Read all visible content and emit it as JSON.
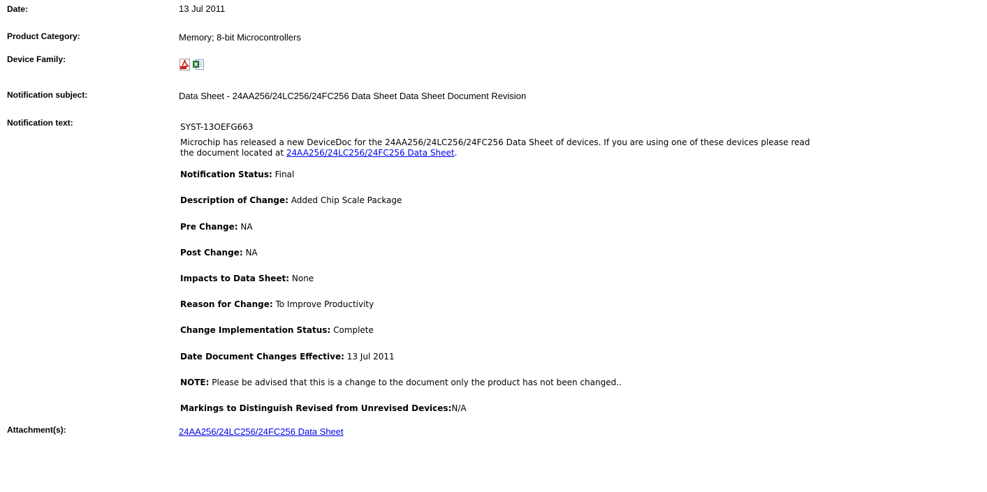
{
  "fields": {
    "date": {
      "label": "Date:",
      "value": "13 Jul 2011"
    },
    "product_category": {
      "label": "Product Category:",
      "value": "Memory; 8-bit Microcontrollers"
    },
    "device_family": {
      "label": "Device Family:",
      "icons": [
        "pdf-icon",
        "excel-icon"
      ]
    },
    "notification_subject": {
      "label": "Notification subject:",
      "value": "Data Sheet - 24AA256/24LC256/24FC256 Data Sheet Data Sheet Document Revision"
    },
    "notification_text": {
      "label": "Notification text:"
    },
    "attachments": {
      "label": "Attachment(s):",
      "link": "24AA256/24LC256/24FC256 Data Sheet"
    }
  },
  "notification": {
    "id": "SYST-13OEFG663",
    "intro_line1": "Microchip has released a new DeviceDoc for the 24AA256/24LC256/24FC256 Data Sheet of devices. If you are using one of these devices please read",
    "intro_line2_prefix": "the document located at ",
    "intro_link": "24AA256/24LC256/24FC256 Data Sheet",
    "intro_line2_suffix": ".",
    "status": {
      "label": "Notification Status:",
      "value": " Final"
    },
    "description": {
      "label": "Description of Change:",
      "value": " Added Chip Scale Package"
    },
    "pre_change": {
      "label": "Pre Change:",
      "value": " NA"
    },
    "post_change": {
      "label": "Post Change:",
      "value": " NA"
    },
    "impacts": {
      "label": "Impacts to Data Sheet:",
      "value": " None"
    },
    "reason": {
      "label": "Reason for Change:",
      "value": " To Improve Productivity"
    },
    "implementation": {
      "label": "Change Implementation Status:",
      "value": " Complete"
    },
    "effective_date": {
      "label": "Date Document Changes Effective:",
      "value": " 13 Jul 2011"
    },
    "note": {
      "label": "NOTE:",
      "value": " Please be advised that this is a change to the document only the product has not been changed.."
    },
    "markings": {
      "label": "Markings to Distinguish Revised from Unrevised Devices:",
      "value": "N/A"
    }
  },
  "colors": {
    "link": "#0000ee",
    "pdf_red": "#cc1f1f",
    "excel_green": "#2e8b3a"
  }
}
